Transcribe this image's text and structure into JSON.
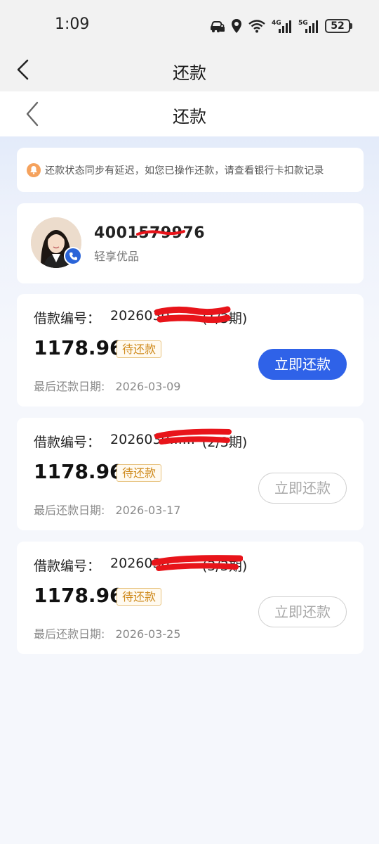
{
  "status_bar": {
    "time": "1:09",
    "battery": "52",
    "network_labels": [
      "4G",
      "5G"
    ]
  },
  "nav_outer": {
    "title": "还款"
  },
  "nav_inner": {
    "title": "还款"
  },
  "notice": {
    "text": "还款状态同步有延迟，如您已操作还款，请查看银行卡扣款记录"
  },
  "contact": {
    "number": "4001579976",
    "name": "轻享优品"
  },
  "loans": [
    {
      "id_label": "借款编号：",
      "id_value": "2026030......",
      "period": "(1/3期)",
      "amount": "1178.96",
      "status": "待还款",
      "date_label": "最后还款日期:",
      "date": "2026-03-09",
      "button": "立即还款",
      "button_active": true
    },
    {
      "id_label": "借款编号：",
      "id_value": "2026030......",
      "period": "(2/3期)",
      "amount": "1178.96",
      "status": "待还款",
      "date_label": "最后还款日期:",
      "date": "2026-03-17",
      "button": "立即还款",
      "button_active": false
    },
    {
      "id_label": "借款编号：",
      "id_value": "2026030......",
      "period": "(3/3期)",
      "amount": "1178.96",
      "status": "待还款",
      "date_label": "最后还款日期:",
      "date": "2026-03-25",
      "button": "立即还款",
      "button_active": false
    }
  ],
  "colors": {
    "primary": "#2f62e8",
    "status_text": "#cf8a1c",
    "status_border": "#e7c27d",
    "notice_icon": "#f5a25d",
    "redaction": "#e8141a"
  }
}
